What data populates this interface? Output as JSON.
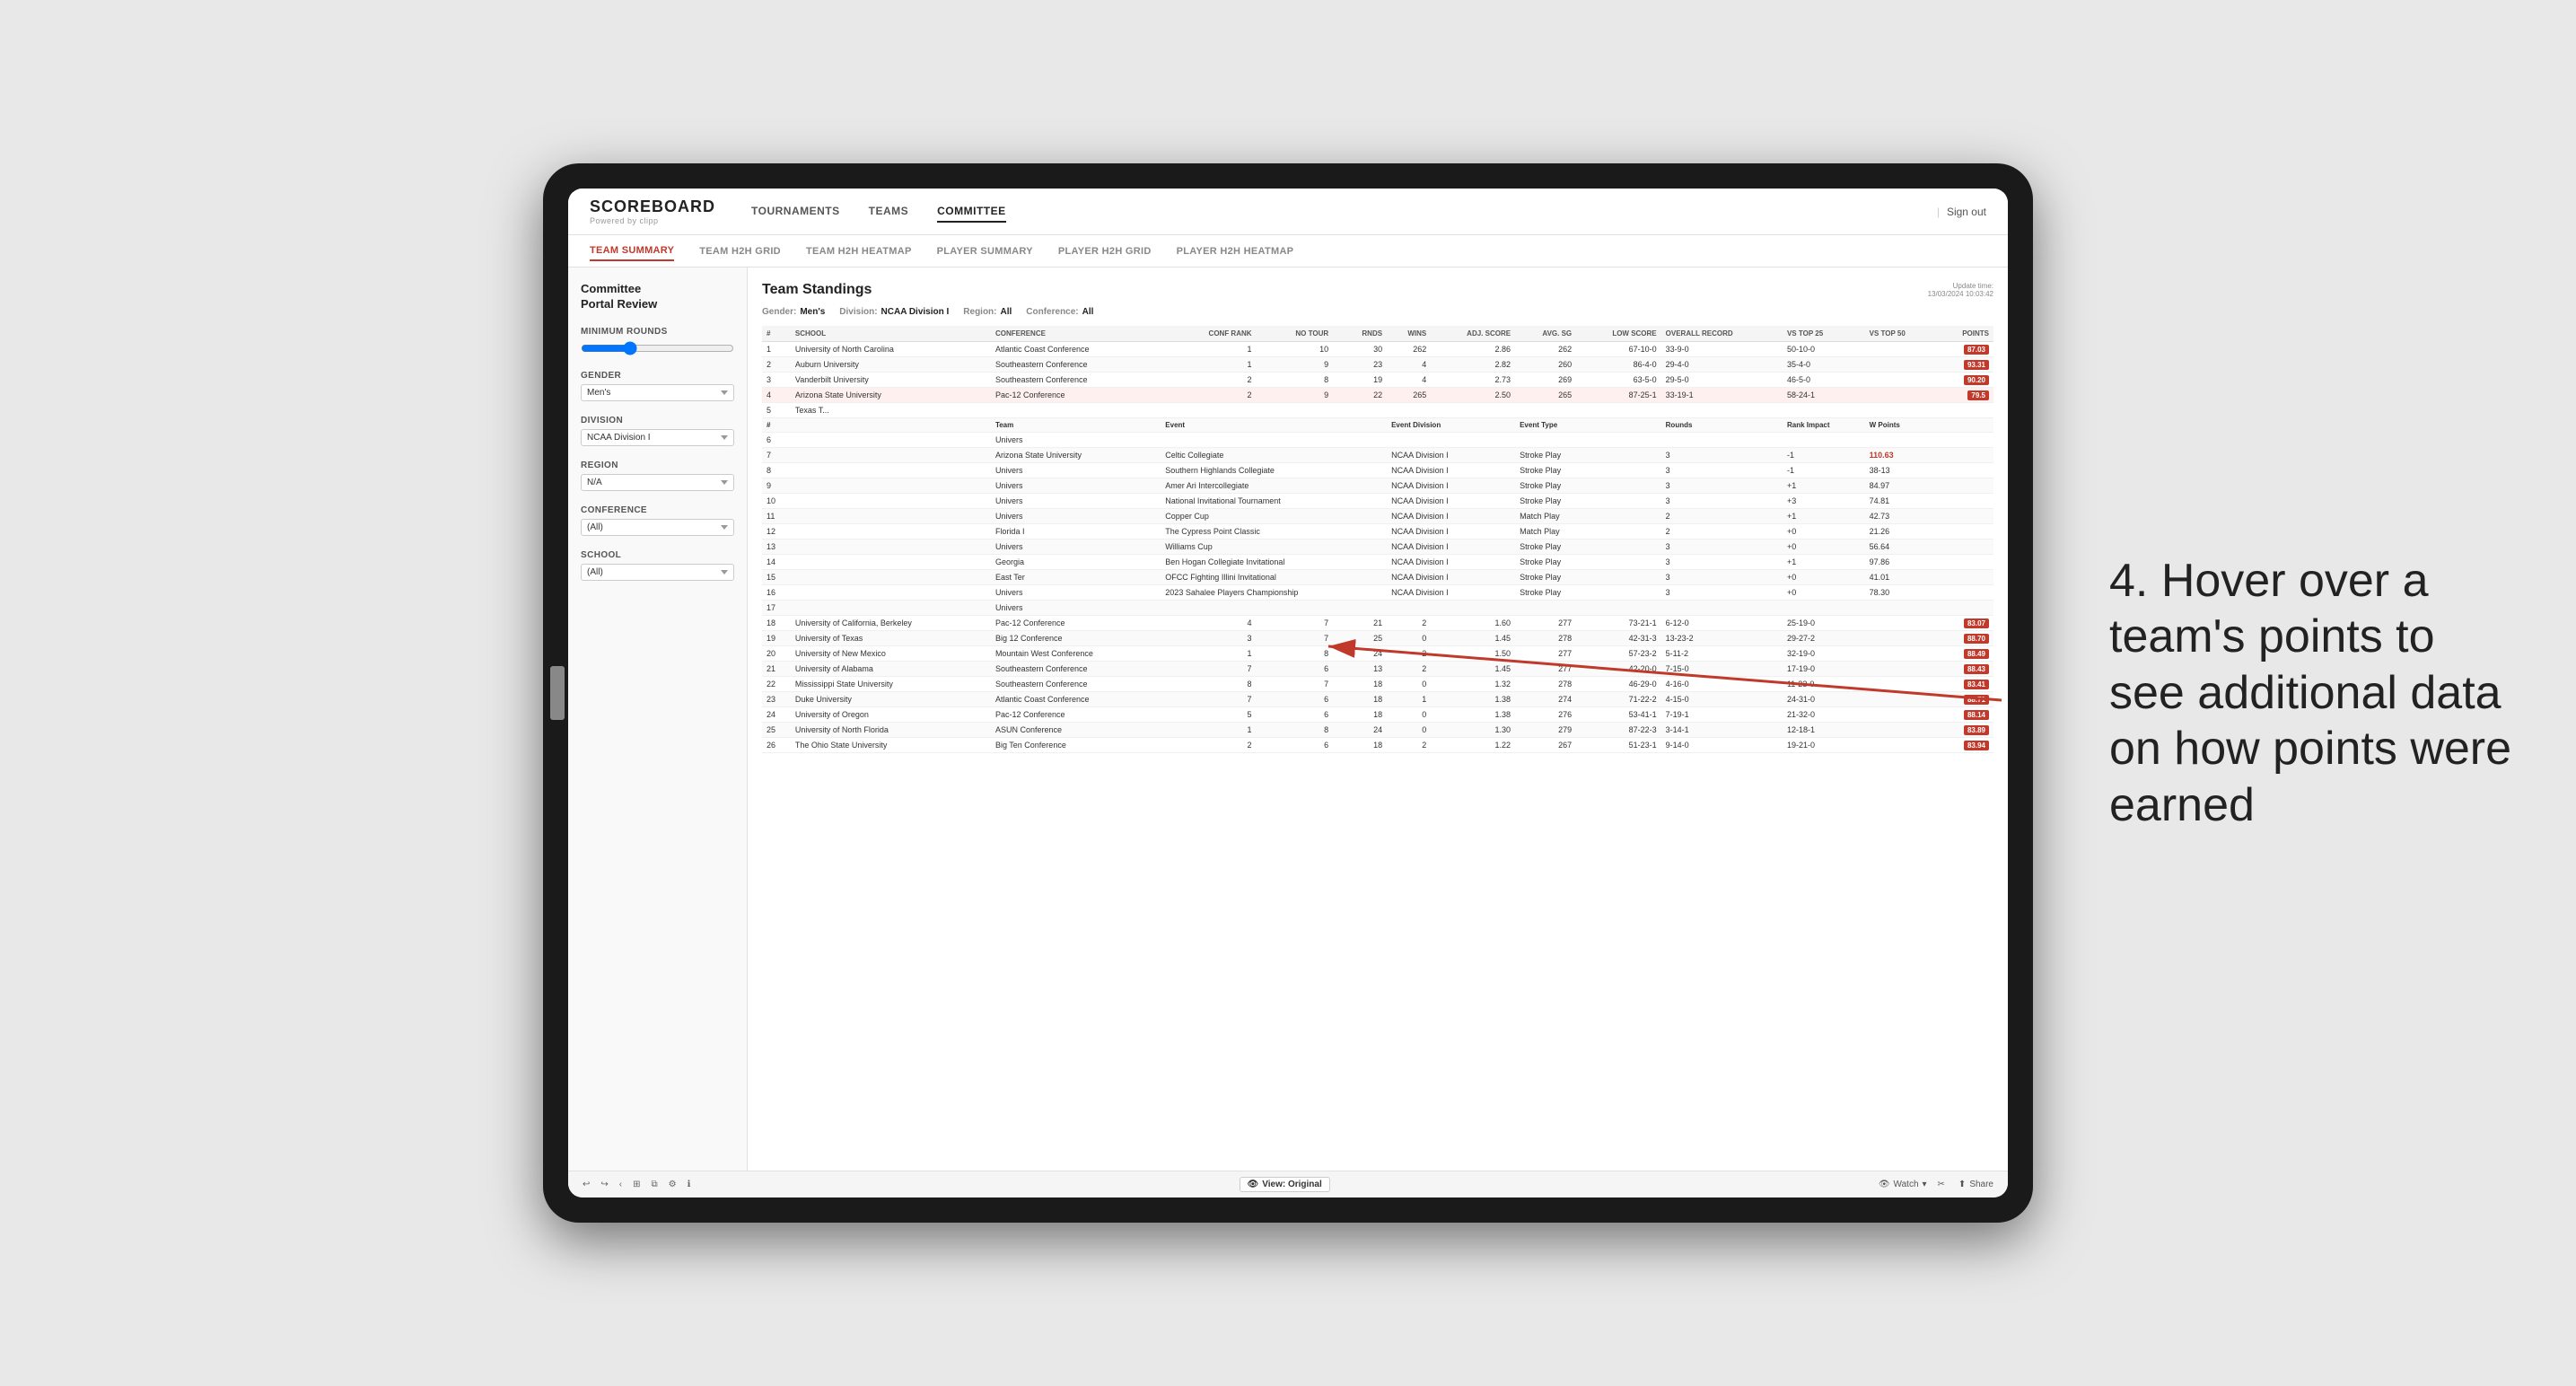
{
  "page": {
    "background": "#e8e8e8"
  },
  "topNav": {
    "logo": "SCOREBOARD",
    "logoSub": "Powered by clipp",
    "navItems": [
      "TOURNAMENTS",
      "TEAMS",
      "COMMITTEE"
    ],
    "activeNav": "COMMITTEE",
    "signOut": "Sign out"
  },
  "subNav": {
    "items": [
      "TEAM SUMMARY",
      "TEAM H2H GRID",
      "TEAM H2H HEATMAP",
      "PLAYER SUMMARY",
      "PLAYER H2H GRID",
      "PLAYER H2H HEATMAP"
    ],
    "active": "TEAM SUMMARY"
  },
  "sidebar": {
    "title1": "Committee",
    "title2": "Portal Review",
    "sections": [
      {
        "label": "Minimum Rounds",
        "type": "slider",
        "value": "5"
      },
      {
        "label": "Gender",
        "type": "select",
        "value": "Men's"
      },
      {
        "label": "Division",
        "type": "select",
        "value": "NCAA Division I"
      },
      {
        "label": "Region",
        "type": "select",
        "value": "N/A"
      },
      {
        "label": "Conference",
        "type": "select",
        "value": "(All)"
      },
      {
        "label": "School",
        "type": "select",
        "value": "(All)"
      }
    ]
  },
  "content": {
    "pageTitle": "Committee\nPortal Review",
    "standingsTitle": "Team Standings",
    "updateTime": "Update time:\n13/03/2024 10:03:42",
    "filters": {
      "gender": {
        "label": "Gender:",
        "value": "Men's"
      },
      "division": {
        "label": "Division:",
        "value": "NCAA Division I"
      },
      "region": {
        "label": "Region:",
        "value": "All"
      },
      "conference": {
        "label": "Conference:",
        "value": "All"
      }
    },
    "tableHeaders": [
      "#",
      "School",
      "Conference",
      "Conf Rank",
      "No Tour",
      "Rnds",
      "Wins",
      "Adj. Score",
      "Avg. SG",
      "Low Score",
      "Overall Record",
      "Vs Top 25",
      "Vs Top 50",
      "Points"
    ],
    "rows": [
      {
        "rank": 1,
        "school": "University of North Carolina",
        "conference": "Atlantic Coast Conference",
        "confRank": 1,
        "tours": 10,
        "rnds": 30,
        "wins": 262,
        "adjScore": 2.86,
        "avgSG": 262,
        "lowScore": "67-10-0",
        "record": "33-9-0",
        "vsTop25": "50-10-0",
        "vsTop50": "87.03",
        "points": "87.03",
        "highlight": false
      },
      {
        "rank": 2,
        "school": "Auburn University",
        "conference": "Southeastern Conference",
        "confRank": 1,
        "tours": 9,
        "rnds": 23,
        "wins": 4,
        "adjScore": 2.82,
        "avgSG": 260,
        "lowScore": "86-4-0",
        "record": "29-4-0",
        "vsTop25": "35-4-0",
        "vsTop50": "93.31",
        "points": "93.31",
        "highlight": false
      },
      {
        "rank": 3,
        "school": "Vanderbilt University",
        "conference": "Southeastern Conference",
        "confRank": 2,
        "tours": 8,
        "rnds": 19,
        "wins": 4,
        "adjScore": 2.73,
        "avgSG": 269,
        "lowScore": "63-5-0",
        "record": "29-5-0",
        "vsTop25": "46-5-0",
        "vsTop50": "90.20",
        "points": "90.20",
        "highlight": false
      },
      {
        "rank": 4,
        "school": "Arizona State University",
        "conference": "Pac-12 Conference",
        "confRank": 2,
        "tours": 9,
        "rnds": 22,
        "wins": 265,
        "adjScore": 2.5,
        "avgSG": 265,
        "lowScore": "87-25-1",
        "record": "33-19-1",
        "vsTop25": "58-24-1",
        "vsTop50": "79.5",
        "points": "79.5",
        "highlight": true
      },
      {
        "rank": 5,
        "school": "Texas T...",
        "conference": "",
        "confRank": "",
        "tours": "",
        "rnds": "",
        "wins": "",
        "adjScore": "",
        "avgSG": "",
        "lowScore": "",
        "record": "",
        "vsTop25": "",
        "vsTop50": "",
        "points": "",
        "highlight": false,
        "isExpanded": true
      }
    ],
    "expandedRows": [
      {
        "rank": 6,
        "team": "Univers",
        "event": "",
        "eventDivision": "",
        "eventType": "",
        "rounds": "",
        "rankImpact": "",
        "wPoints": ""
      },
      {
        "rank": 7,
        "team": "Arizona State University",
        "event": "Celtic Collegiate",
        "eventDivision": "NCAA Division I",
        "eventType": "Stroke Play",
        "rounds": 3,
        "rankImpact": -1,
        "wPoints": "110.63"
      },
      {
        "rank": 8,
        "team": "Univers",
        "event": "Southern Highlands Collegiate",
        "eventDivision": "NCAA Division I",
        "eventType": "Stroke Play",
        "rounds": 3,
        "rankImpact": -1,
        "wPoints": "38-13"
      },
      {
        "rank": 9,
        "team": "Univers",
        "event": "Amer Ari Intercollegiate",
        "eventDivision": "NCAA Division I",
        "eventType": "Stroke Play",
        "rounds": 3,
        "rankImpact": "+1",
        "wPoints": "84.97"
      },
      {
        "rank": 10,
        "team": "Univers",
        "event": "National Invitational Tournament",
        "eventDivision": "NCAA Division I",
        "eventType": "Stroke Play",
        "rounds": 3,
        "rankImpact": "+3",
        "wPoints": "74.81"
      },
      {
        "rank": 11,
        "team": "Univers",
        "event": "Copper Cup",
        "eventDivision": "NCAA Division I",
        "eventType": "Match Play",
        "rounds": 2,
        "rankImpact": "+1",
        "wPoints": "42.73"
      },
      {
        "rank": 12,
        "team": "Florida I",
        "event": "The Cypress Point Classic",
        "eventDivision": "NCAA Division I",
        "eventType": "Match Play",
        "rounds": 2,
        "rankImpact": "+0",
        "wPoints": "21.26"
      },
      {
        "rank": 13,
        "team": "Univers",
        "event": "Williams Cup",
        "eventDivision": "NCAA Division I",
        "eventType": "Stroke Play",
        "rounds": 3,
        "rankImpact": "+0",
        "wPoints": "56.64"
      },
      {
        "rank": 14,
        "team": "Georgia",
        "event": "Ben Hogan Collegiate Invitational",
        "eventDivision": "NCAA Division I",
        "eventType": "Stroke Play",
        "rounds": 3,
        "rankImpact": "+1",
        "wPoints": "97.86"
      },
      {
        "rank": 15,
        "team": "East Ter",
        "event": "OFCC Fighting Illini Invitational",
        "eventDivision": "NCAA Division I",
        "eventType": "Stroke Play",
        "rounds": 3,
        "rankImpact": "+0",
        "wPoints": "41.01"
      },
      {
        "rank": 16,
        "team": "Univers",
        "event": "2023 Sahalee Players Championship",
        "eventDivision": "NCAA Division I",
        "eventType": "Stroke Play",
        "rounds": 3,
        "rankImpact": "+0",
        "wPoints": "78.30"
      },
      {
        "rank": 17,
        "team": "Univers",
        "event": "",
        "eventDivision": "",
        "eventType": "",
        "rounds": "",
        "rankImpact": "",
        "wPoints": ""
      }
    ],
    "lowerRows": [
      {
        "rank": 18,
        "school": "University of California, Berkeley",
        "conference": "Pac-12 Conference",
        "confRank": 4,
        "tours": 7,
        "rnds": 21,
        "wins": 2,
        "adjScore": 1.6,
        "avgSG": 277,
        "lowScore": "73-21-1",
        "record": "6-12-0",
        "vsTop25": "25-19-0",
        "vsTop50": "83.07"
      },
      {
        "rank": 19,
        "school": "University of Texas",
        "conference": "Big 12 Conference",
        "confRank": 3,
        "tours": 7,
        "rnds": 25,
        "wins": 0,
        "adjScore": 1.45,
        "avgSG": 278,
        "lowScore": "42-31-3",
        "record": "13-23-2",
        "vsTop25": "29-27-2",
        "vsTop50": "88.70"
      },
      {
        "rank": 20,
        "school": "University of New Mexico",
        "conference": "Mountain West Conference",
        "confRank": 1,
        "tours": 8,
        "rnds": 24,
        "wins": 2,
        "adjScore": 1.5,
        "avgSG": 277,
        "lowScore": "57-23-2",
        "record": "5-11-2",
        "vsTop25": "32-19-0",
        "vsTop50": "88.49"
      },
      {
        "rank": 21,
        "school": "University of Alabama",
        "conference": "Southeastern Conference",
        "confRank": 7,
        "tours": 6,
        "rnds": 13,
        "wins": 2,
        "adjScore": 1.45,
        "avgSG": 277,
        "lowScore": "42-20-0",
        "record": "7-15-0",
        "vsTop25": "17-19-0",
        "vsTop50": "88.43"
      },
      {
        "rank": 22,
        "school": "Mississippi State University",
        "conference": "Southeastern Conference",
        "confRank": 8,
        "tours": 7,
        "rnds": 18,
        "wins": 0,
        "adjScore": 1.32,
        "avgSG": 278,
        "lowScore": "46-29-0",
        "record": "4-16-0",
        "vsTop25": "11-23-0",
        "vsTop50": "83.41"
      },
      {
        "rank": 23,
        "school": "Duke University",
        "conference": "Atlantic Coast Conference",
        "confRank": 7,
        "tours": 6,
        "rnds": 18,
        "wins": 1,
        "adjScore": 1.38,
        "avgSG": 274,
        "lowScore": "71-22-2",
        "record": "4-15-0",
        "vsTop25": "24-31-0",
        "vsTop50": "88.71"
      },
      {
        "rank": 24,
        "school": "University of Oregon",
        "conference": "Pac-12 Conference",
        "confRank": 5,
        "tours": 6,
        "rnds": 18,
        "wins": 0,
        "adjScore": 1.38,
        "avgSG": 276,
        "lowScore": "53-41-1",
        "record": "7-19-1",
        "vsTop25": "21-32-0",
        "vsTop50": "88.14"
      },
      {
        "rank": 25,
        "school": "University of North Florida",
        "conference": "ASUN Conference",
        "confRank": 1,
        "tours": 8,
        "rnds": 24,
        "wins": 0,
        "adjScore": 1.3,
        "avgSG": 279,
        "lowScore": "87-22-3",
        "record": "3-14-1",
        "vsTop25": "12-18-1",
        "vsTop50": "83.89"
      },
      {
        "rank": 26,
        "school": "The Ohio State University",
        "conference": "Big Ten Conference",
        "confRank": 2,
        "tours": 6,
        "rnds": 18,
        "wins": 2,
        "adjScore": 1.22,
        "avgSG": 267,
        "lowScore": "51-23-1",
        "record": "9-14-0",
        "vsTop25": "19-21-0",
        "vsTop50": "83.94"
      }
    ]
  },
  "bottomToolbar": {
    "viewLabel": "View: Original",
    "watchLabel": "Watch",
    "shareLabel": "Share",
    "clipLabel": "Clip"
  },
  "annotation": {
    "text": "4. Hover over a team's points to see additional data on how points were earned"
  }
}
